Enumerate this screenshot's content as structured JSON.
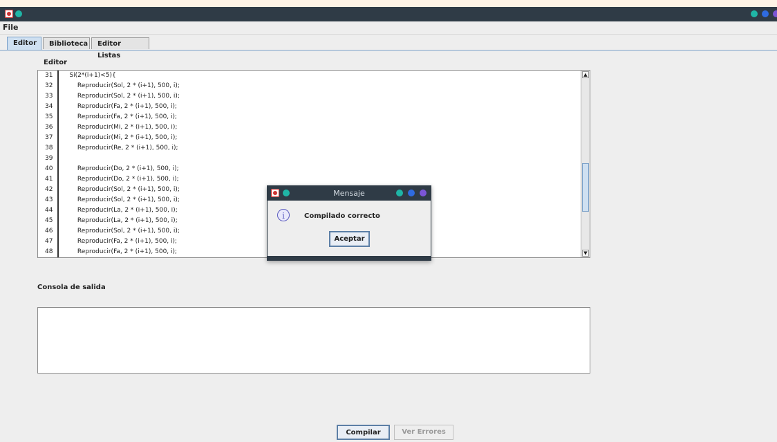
{
  "window": {
    "title": ""
  },
  "menubar": {
    "file_label": "File"
  },
  "tabs": [
    {
      "label": "Editor"
    },
    {
      "label": "Biblioteca"
    },
    {
      "label": "Editor Listas"
    }
  ],
  "editor": {
    "label": "Editor",
    "lines": [
      {
        "n": "31",
        "code": "    Si(2*(i+1)<5){"
      },
      {
        "n": "32",
        "code": "        Reproducir(Sol, 2 * (i+1), 500, i);"
      },
      {
        "n": "33",
        "code": "        Reproducir(Sol, 2 * (i+1), 500, i);"
      },
      {
        "n": "34",
        "code": "        Reproducir(Fa, 2 * (i+1), 500, i);"
      },
      {
        "n": "35",
        "code": "        Reproducir(Fa, 2 * (i+1), 500, i);"
      },
      {
        "n": "36",
        "code": "        Reproducir(Mi, 2 * (i+1), 500, i);"
      },
      {
        "n": "37",
        "code": "        Reproducir(Mi, 2 * (i+1), 500, i);"
      },
      {
        "n": "38",
        "code": "        Reproducir(Re, 2 * (i+1), 500, i);"
      },
      {
        "n": "39",
        "code": ""
      },
      {
        "n": "40",
        "code": "        Reproducir(Do, 2 * (i+1), 500, i);"
      },
      {
        "n": "41",
        "code": "        Reproducir(Do, 2 * (i+1), 500, i);"
      },
      {
        "n": "42",
        "code": "        Reproducir(Sol, 2 * (i+1), 500, i);"
      },
      {
        "n": "43",
        "code": "        Reproducir(Sol, 2 * (i+1), 500, i);"
      },
      {
        "n": "44",
        "code": "        Reproducir(La, 2 * (i+1), 500, i);"
      },
      {
        "n": "45",
        "code": "        Reproducir(La, 2 * (i+1), 500, i);"
      },
      {
        "n": "46",
        "code": "        Reproducir(Sol, 2 * (i+1), 500, i);"
      },
      {
        "n": "47",
        "code": "        Reproducir(Fa, 2 * (i+1), 500, i);"
      },
      {
        "n": "48",
        "code": "        Reproducir(Fa, 2 * (i+1), 500, i);"
      }
    ]
  },
  "console": {
    "label": "Consola de salida",
    "content": ""
  },
  "buttons": {
    "compile": "Compilar",
    "errors": "Ver Errores"
  },
  "dialog": {
    "title": "Mensaje",
    "icon": "info-icon",
    "message": "Compilado correcto",
    "ok": "Aceptar"
  },
  "colors": {
    "titlebar": "#2f3b46",
    "dot_teal": "#1fb5a6",
    "dot_blue": "#2f6be0",
    "dot_purple": "#7b55d6"
  }
}
